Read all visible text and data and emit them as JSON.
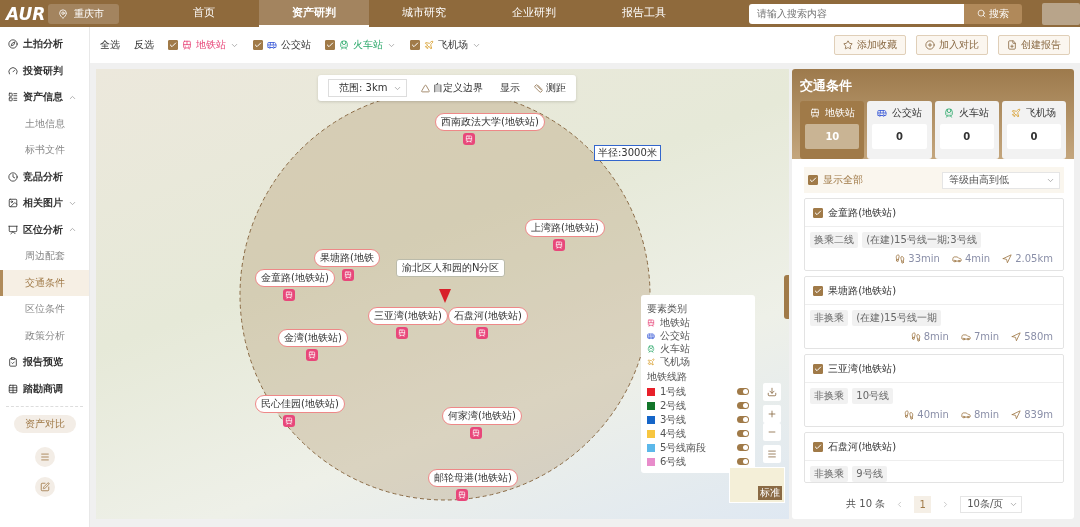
{
  "header": {
    "logo": "AUR",
    "city": "重庆市",
    "nav": [
      {
        "label": "首页",
        "selected": false
      },
      {
        "label": "资产研判",
        "selected": true
      },
      {
        "label": "城市研究",
        "selected": false
      },
      {
        "label": "企业研判",
        "selected": false
      },
      {
        "label": "报告工具",
        "selected": false
      }
    ],
    "search": {
      "placeholder": "请输入搜索内容",
      "button": "搜索"
    }
  },
  "sidebar": {
    "items": [
      {
        "label": "土拍分析"
      },
      {
        "label": "投资研判"
      },
      {
        "label": "资产信息",
        "expanded": true,
        "children": [
          {
            "label": "土地信息",
            "selected": false
          },
          {
            "label": "标书文件",
            "selected": false
          }
        ]
      },
      {
        "label": "竞品分析"
      },
      {
        "label": "相关图片",
        "expanded": false
      },
      {
        "label": "区位分析",
        "expanded": true,
        "children": [
          {
            "label": "周边配套",
            "selected": false
          },
          {
            "label": "交通条件",
            "selected": true
          },
          {
            "label": "区位条件",
            "selected": false
          },
          {
            "label": "政策分析",
            "selected": false
          }
        ]
      },
      {
        "label": "报告预览"
      },
      {
        "label": "踏勘商调"
      }
    ],
    "compare": "资产对比"
  },
  "filter_bar": {
    "select_all": "全选",
    "invert": "反选",
    "filters": [
      {
        "kind": "metro",
        "label": "地铁站",
        "checked": true,
        "dropdown": true
      },
      {
        "kind": "bus",
        "label": "公交站",
        "checked": true,
        "dropdown": false
      },
      {
        "kind": "train",
        "label": "火车站",
        "checked": true,
        "dropdown": true
      },
      {
        "kind": "plane",
        "label": "飞机场",
        "checked": true,
        "dropdown": true
      }
    ],
    "actions": [
      {
        "kind": "star",
        "label": "添加收藏"
      },
      {
        "kind": "plus",
        "label": "加入对比"
      },
      {
        "kind": "report",
        "label": "创建报告"
      }
    ]
  },
  "map": {
    "toolbar": {
      "range": "范围: 3km",
      "tools": [
        {
          "kind": "boundary",
          "label": "自定义边界"
        },
        {
          "kind": "display",
          "label": "显示"
        },
        {
          "kind": "measure",
          "label": "测距"
        }
      ]
    },
    "radius_label": "半径:3000米",
    "center_label": "渝北区人和园的N分区",
    "stations": [
      {
        "label": "西南政法大学(地铁站)"
      },
      {
        "label": "上湾路(地铁站)"
      },
      {
        "label": "金童路(地铁站)"
      },
      {
        "label": "果塘路(地铁"
      },
      {
        "label": "三亚湾(地铁站)"
      },
      {
        "label": "石盘河(地铁站)"
      },
      {
        "label": "金湾(地铁站)"
      },
      {
        "label": "民心佳园(地铁站)"
      },
      {
        "label": "何家湾(地铁站)"
      },
      {
        "label": "邮轮母港(地铁站)"
      }
    ],
    "legend": {
      "category_title": "要素类别",
      "categories": [
        {
          "kind": "metro",
          "label": "地铁站"
        },
        {
          "kind": "bus",
          "label": "公交站"
        },
        {
          "kind": "train",
          "label": "火车站"
        },
        {
          "kind": "plane",
          "label": "飞机场"
        }
      ],
      "lines_title": "地铁线路",
      "lines": [
        {
          "label": "1号线",
          "color": "#e8202a",
          "on": true
        },
        {
          "label": "2号线",
          "color": "#12762a",
          "on": true
        },
        {
          "label": "3号线",
          "color": "#1565c8",
          "on": true
        },
        {
          "label": "4号线",
          "color": "#f7c640",
          "on": true
        },
        {
          "label": "5号线南段",
          "color": "#5cb8ea",
          "on": true
        },
        {
          "label": "6号线",
          "color": "#e88ccb",
          "on": true
        }
      ]
    },
    "minimap_label": "标准"
  },
  "panel": {
    "title": "交通条件",
    "tabs": [
      {
        "kind": "metro",
        "label": "地铁站",
        "count": "10",
        "selected": true
      },
      {
        "kind": "bus",
        "label": "公交站",
        "count": "0",
        "selected": false
      },
      {
        "kind": "train",
        "label": "火车站",
        "count": "0",
        "selected": false
      },
      {
        "kind": "plane",
        "label": "飞机场",
        "count": "0",
        "selected": false
      }
    ],
    "show_all": {
      "label": "显示全部",
      "checked": true
    },
    "sort": "等级由高到低",
    "results": [
      {
        "name": "金童路(地铁站)",
        "checked": true,
        "tags": [
          "换乘二线",
          "(在建)15号线一期;3号线"
        ],
        "walk": "33min",
        "drive": "4min",
        "distance": "2.05km"
      },
      {
        "name": "果塘路(地铁站)",
        "checked": true,
        "tags": [
          "非换乘",
          "(在建)15号线一期"
        ],
        "walk": "8min",
        "drive": "7min",
        "distance": "580m"
      },
      {
        "name": "三亚湾(地铁站)",
        "checked": true,
        "tags": [
          "非换乘",
          "10号线"
        ],
        "walk": "40min",
        "drive": "8min",
        "distance": "839m"
      },
      {
        "name": "石盘河(地铁站)",
        "checked": true,
        "tags": [
          "非换乘",
          "9号线"
        ]
      }
    ],
    "pagination": {
      "total": "共 10 条",
      "page": "1",
      "page_size": "10条/页"
    }
  }
}
